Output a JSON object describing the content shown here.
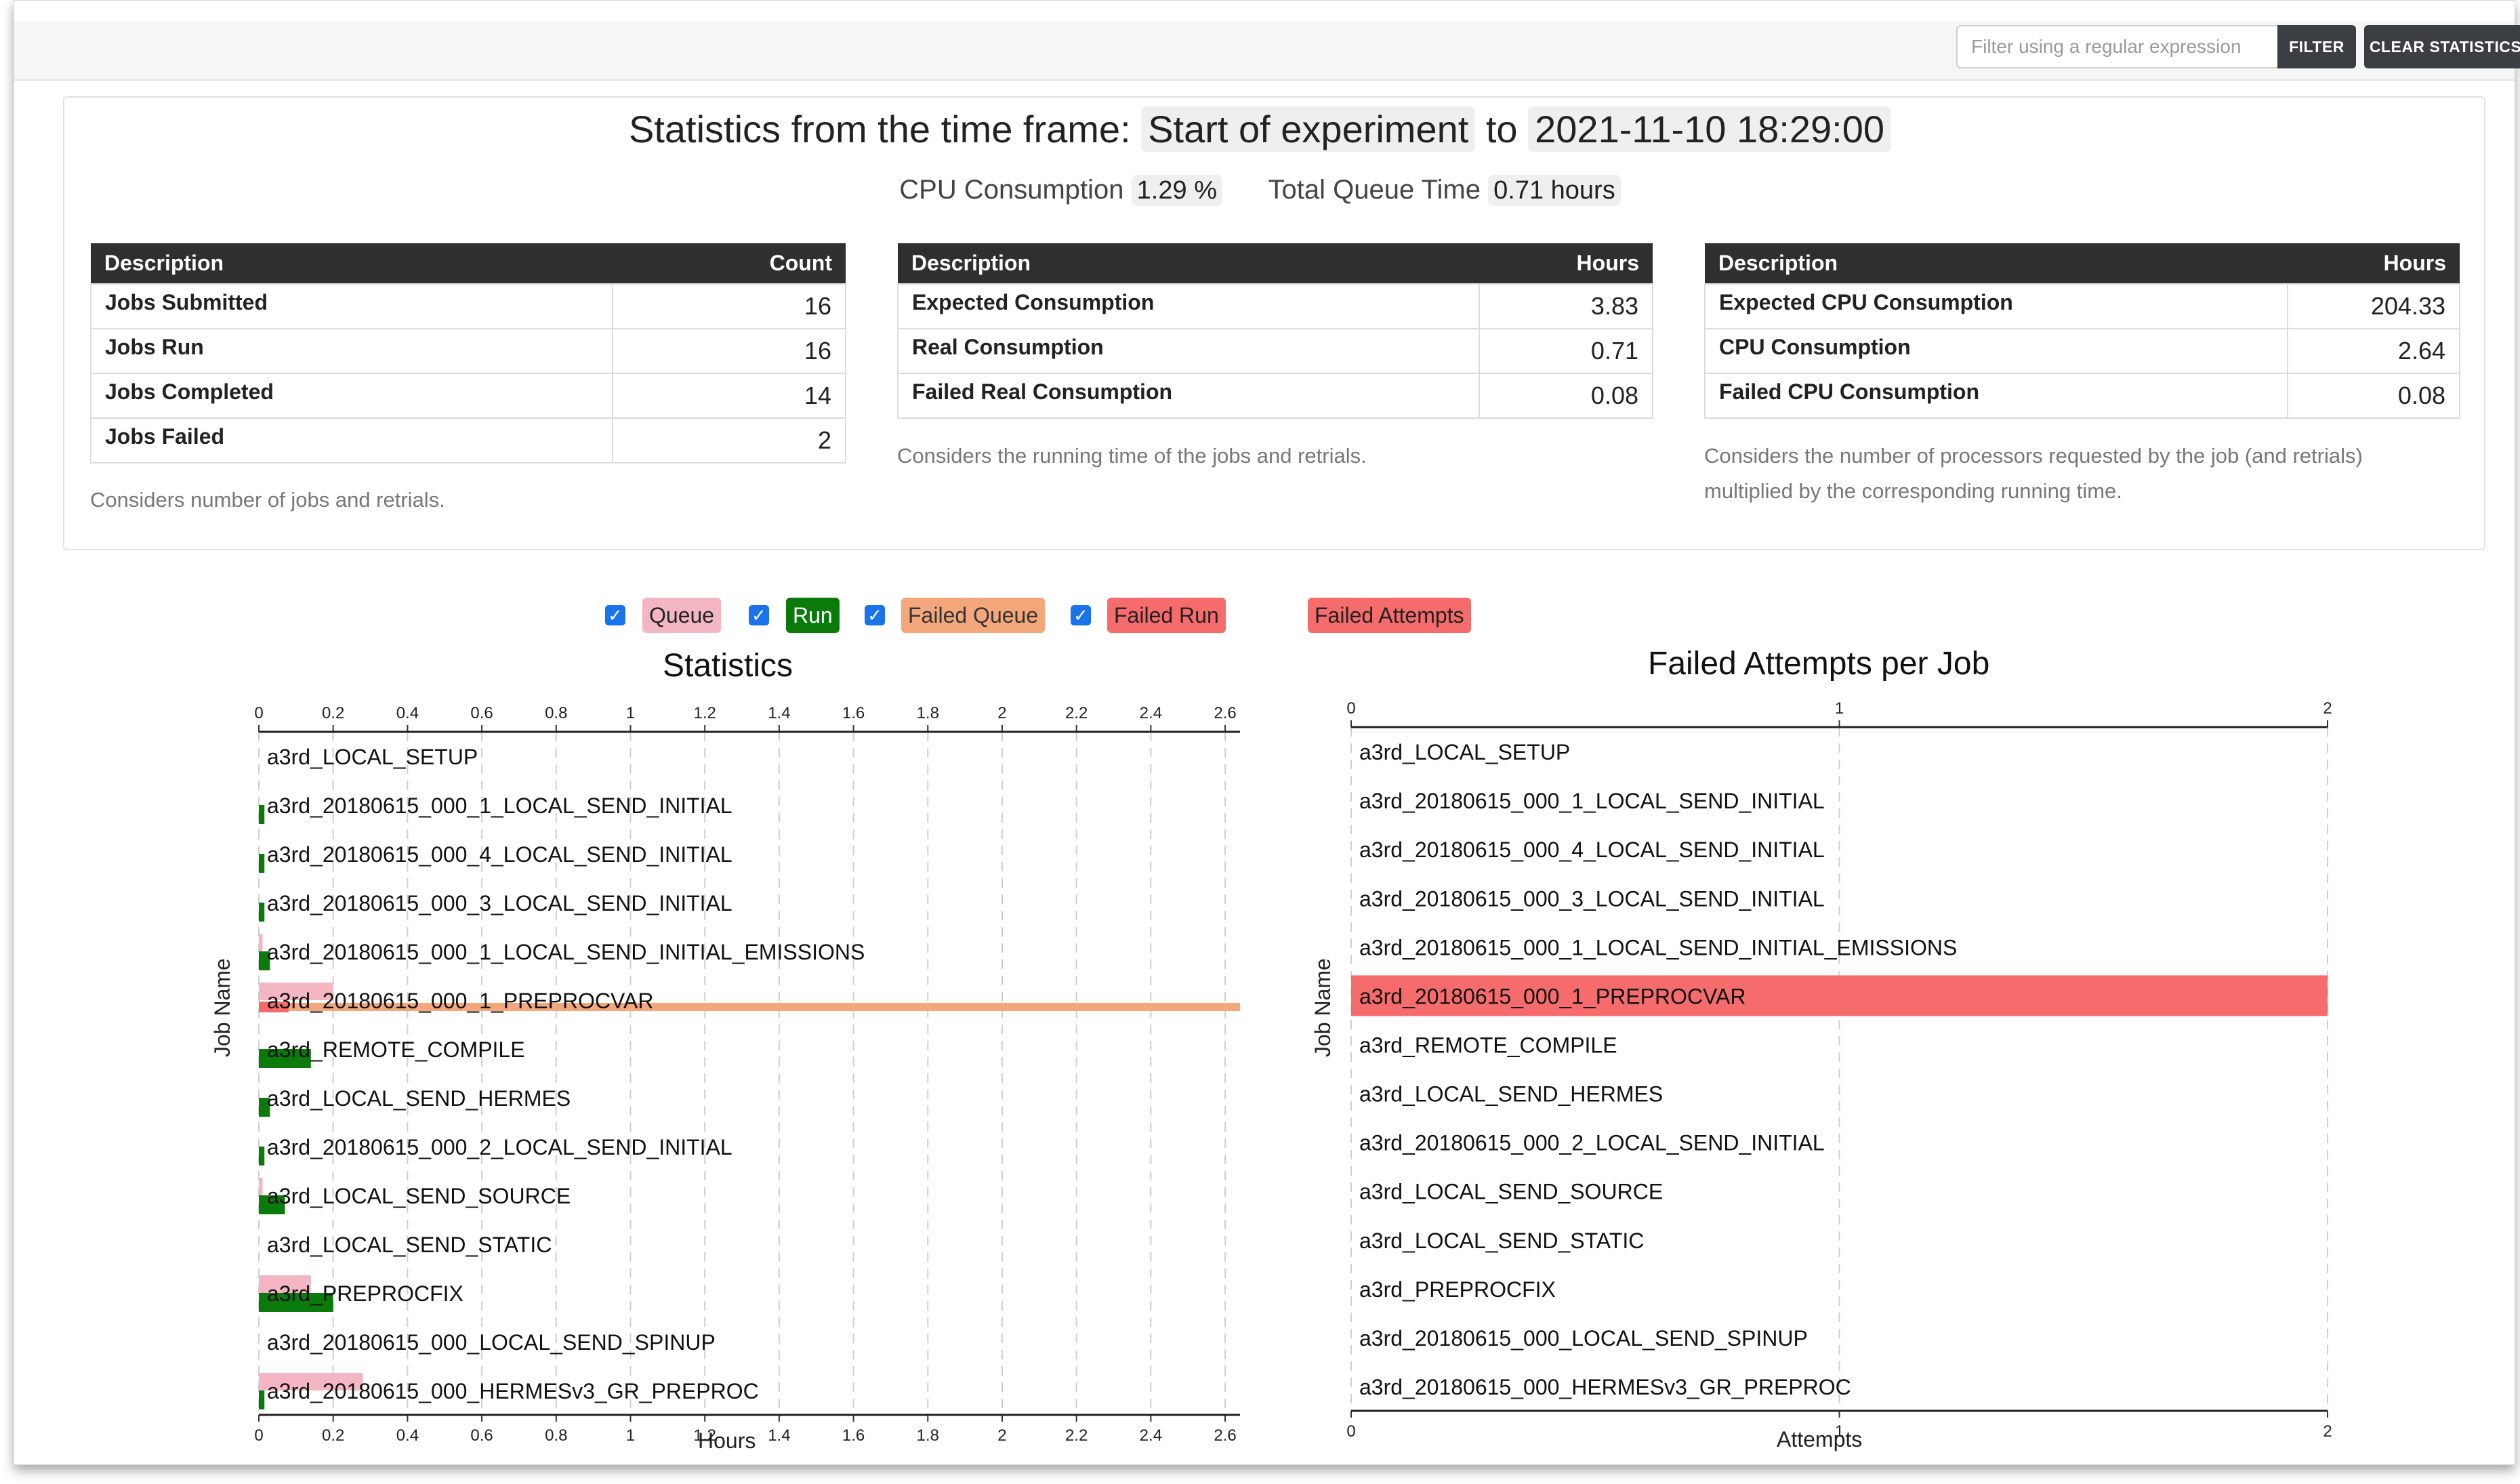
{
  "toolbar": {
    "filter_placeholder": "Filter using a regular expression",
    "filter_label": "FILTER",
    "clear_label": "CLEAR STATISTICS"
  },
  "stats": {
    "title_prefix": "Statistics from the time frame:",
    "from": "Start of experiment",
    "to_word": "to",
    "to": "2021-11-10 18:29:00",
    "cpu_label": "CPU Consumption",
    "cpu_value": "1.29 %",
    "queue_label": "Total Queue Time",
    "queue_value": "0.71 hours",
    "tables": [
      {
        "headers": [
          "Description",
          "Count"
        ],
        "rows": [
          [
            "Jobs Submitted",
            "16"
          ],
          [
            "Jobs Run",
            "16"
          ],
          [
            "Jobs Completed",
            "14"
          ],
          [
            "Jobs Failed",
            "2"
          ]
        ],
        "note": "Considers number of jobs and retrials."
      },
      {
        "headers": [
          "Description",
          "Hours"
        ],
        "rows": [
          [
            "Expected Consumption",
            "3.83"
          ],
          [
            "Real Consumption",
            "0.71"
          ],
          [
            "Failed Real Consumption",
            "0.08"
          ]
        ],
        "note": "Considers the running time of the jobs and retrials."
      },
      {
        "headers": [
          "Description",
          "Hours"
        ],
        "rows": [
          [
            "Expected CPU Consumption",
            "204.33"
          ],
          [
            "CPU Consumption",
            "2.64"
          ],
          [
            "Failed CPU Consumption",
            "0.08"
          ]
        ],
        "note_line1": "Considers the number of processors requested by the job (and retrials)",
        "note_line2": "multiplied by the corresponding running time."
      }
    ]
  },
  "legend": {
    "items": [
      "Queue",
      "Run",
      "Failed Queue",
      "Failed Run"
    ],
    "failed_attempts": "Failed Attempts",
    "check_glyph": "✓",
    "colors": {
      "queue": "#f4b6c2",
      "run": "#0a7a0a",
      "failed_queue": "#f4a77a",
      "failed_run": "#f66b6b"
    }
  },
  "chart_data": [
    {
      "type": "bar",
      "orientation": "horizontal-stacked",
      "title": "Statistics",
      "xlabel": "Hours",
      "ylabel": "Job Name",
      "xlim": [
        0,
        2.64
      ],
      "xticks": [
        "0",
        "0.2",
        "0.4",
        "0.6",
        "0.8",
        "1",
        "1.2",
        "1.4",
        "1.6",
        "1.8",
        "2",
        "2.2",
        "2.4",
        "2.6"
      ],
      "grid": true,
      "categories": [
        "a3rd_LOCAL_SETUP",
        "a3rd_20180615_000_1_LOCAL_SEND_INITIAL",
        "a3rd_20180615_000_4_LOCAL_SEND_INITIAL",
        "a3rd_20180615_000_3_LOCAL_SEND_INITIAL",
        "a3rd_20180615_000_1_LOCAL_SEND_INITIAL_EMISSIONS",
        "a3rd_20180615_000_1_PREPROCVAR",
        "a3rd_REMOTE_COMPILE",
        "a3rd_LOCAL_SEND_HERMES",
        "a3rd_20180615_000_2_LOCAL_SEND_INITIAL",
        "a3rd_LOCAL_SEND_SOURCE",
        "a3rd_LOCAL_SEND_STATIC",
        "a3rd_PREPROCFIX",
        "a3rd_20180615_000_LOCAL_SEND_SPINUP",
        "a3rd_20180615_000_HERMESv3_GR_PREPROC"
      ],
      "series": [
        {
          "name": "Queue",
          "values": [
            0,
            0,
            0,
            0,
            0.01,
            0.2,
            0,
            0,
            0,
            0.01,
            0,
            0.14,
            0,
            0.28
          ]
        },
        {
          "name": "Run",
          "values": [
            0,
            0.015,
            0.015,
            0.015,
            0.03,
            0,
            0.14,
            0.03,
            0.015,
            0.07,
            0,
            0.2,
            0,
            0.015
          ]
        },
        {
          "name": "Failed Queue",
          "values": [
            0,
            0,
            0,
            0,
            0,
            2.64,
            0,
            0,
            0,
            0,
            0,
            0,
            0,
            0
          ]
        },
        {
          "name": "Failed Run",
          "values": [
            0,
            0,
            0,
            0,
            0,
            0.08,
            0,
            0,
            0,
            0,
            0,
            0,
            0,
            0
          ]
        }
      ]
    },
    {
      "type": "bar",
      "orientation": "horizontal",
      "title": "Failed Attempts per Job",
      "xlabel": "Attempts",
      "ylabel": "Job Name",
      "xlim": [
        0,
        2
      ],
      "xticks": [
        "0",
        "1",
        "2"
      ],
      "grid": true,
      "categories": [
        "a3rd_LOCAL_SETUP",
        "a3rd_20180615_000_1_LOCAL_SEND_INITIAL",
        "a3rd_20180615_000_4_LOCAL_SEND_INITIAL",
        "a3rd_20180615_000_3_LOCAL_SEND_INITIAL",
        "a3rd_20180615_000_1_LOCAL_SEND_INITIAL_EMISSIONS",
        "a3rd_20180615_000_1_PREPROCVAR",
        "a3rd_REMOTE_COMPILE",
        "a3rd_LOCAL_SEND_HERMES",
        "a3rd_20180615_000_2_LOCAL_SEND_INITIAL",
        "a3rd_LOCAL_SEND_SOURCE",
        "a3rd_LOCAL_SEND_STATIC",
        "a3rd_PREPROCFIX",
        "a3rd_20180615_000_LOCAL_SEND_SPINUP",
        "a3rd_20180615_000_HERMESv3_GR_PREPROC"
      ],
      "series": [
        {
          "name": "Failed Attempts",
          "values": [
            0,
            0,
            0,
            0,
            0,
            2,
            0,
            0,
            0,
            0,
            0,
            0,
            0,
            0
          ]
        }
      ]
    }
  ]
}
